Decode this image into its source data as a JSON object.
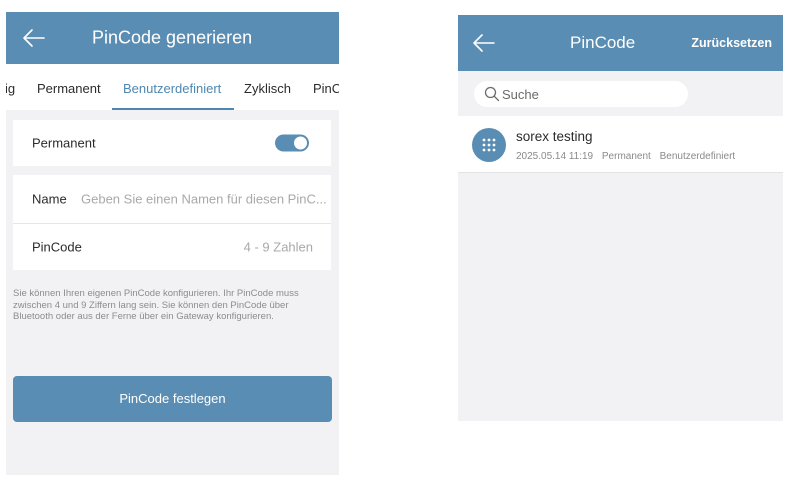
{
  "left_screen": {
    "header": {
      "title": "PinCode generieren"
    },
    "tabs": [
      {
        "label": "ig"
      },
      {
        "label": "Permanent"
      },
      {
        "label": "Benutzerdefiniert"
      },
      {
        "label": "Zyklisch"
      },
      {
        "label": "PinC"
      }
    ],
    "active_tab": "Benutzerdefiniert",
    "permanent": {
      "label": "Permanent",
      "toggle_on": true
    },
    "name_field": {
      "label": "Name",
      "placeholder": "Geben Sie einen Namen für diesen PinC..."
    },
    "pincode_field": {
      "label": "PinCode",
      "placeholder": "4 - 9 Zahlen"
    },
    "hint": "Sie können Ihren eigenen PinCode konfigurieren. Ihr PinCode muss zwischen 4 und 9 Ziffern lang sein. Sie können den PinCode über Bluetooth oder aus der Ferne über ein Gateway konfigurieren.",
    "submit_label": "PinCode festlegen"
  },
  "right_screen": {
    "header": {
      "title": "PinCode",
      "reset_label": "Zurücksetzen"
    },
    "search": {
      "placeholder": "Suche"
    },
    "items": [
      {
        "name": "sorex testing",
        "date": "2025.05.14 11:19",
        "type": "Permanent",
        "mode": "Benutzerdefiniert",
        "icon": "keypad-icon"
      }
    ]
  },
  "colors": {
    "primary": "#5a8db3",
    "active_tab": "#4f87b0",
    "background": "#f2f2f4"
  }
}
